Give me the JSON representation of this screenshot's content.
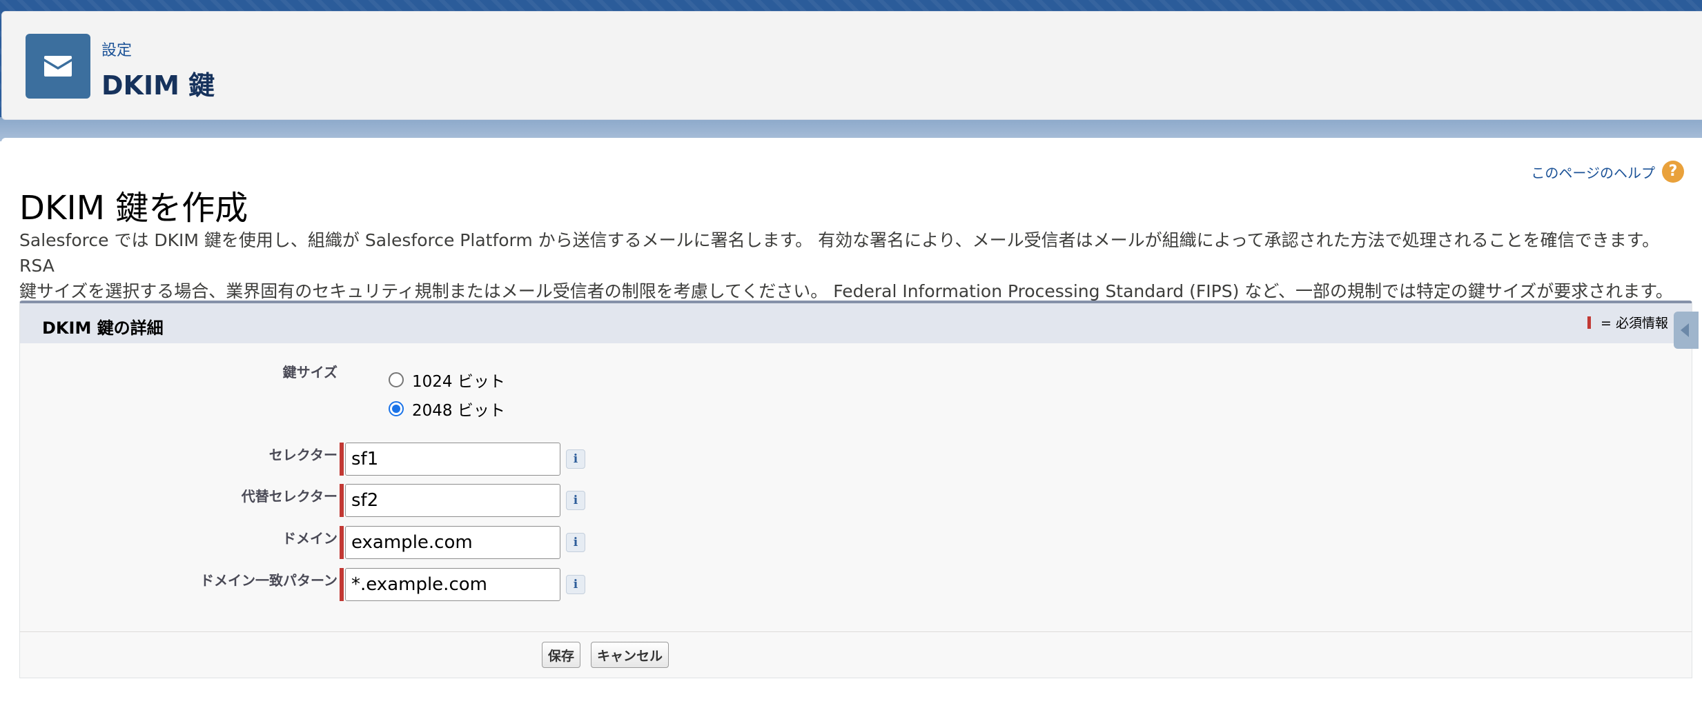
{
  "header": {
    "breadcrumb": "設定",
    "title": "DKIM 鍵",
    "icon": "envelope-icon"
  },
  "page": {
    "heading": "DKIM 鍵を作成",
    "help_link": "このページのヘルプ",
    "help_icon": "help-icon",
    "intro_line1": "Salesforce では DKIM 鍵を使用し、組織が Salesforce Platform から送信するメールに署名します。 有効な署名により、メール受信者はメールが組織によって承認された方法で処理されることを確信できます。 RSA",
    "intro_line2": "鍵サイズを選択する場合、業界固有のセキュリティ規制またはメール受信者の制限を考慮してください。 Federal Information Processing Standard (FIPS) など、一部の規制では特定の鍵サイズが要求されます。"
  },
  "section": {
    "title": "DKIM 鍵の詳細",
    "required_legend": "= 必須情報"
  },
  "form": {
    "key_size_label": "鍵サイズ",
    "key_size_options": [
      {
        "label": "1024 ビット",
        "checked": false
      },
      {
        "label": "2048 ビット",
        "checked": true
      }
    ],
    "selector_label": "セレクター",
    "selector_value": "sf1",
    "alt_selector_label": "代替セレクター",
    "alt_selector_value": "sf2",
    "domain_label": "ドメイン",
    "domain_value": "example.com",
    "domain_pattern_label": "ドメイン一致パターン",
    "domain_pattern_value": "*.example.com",
    "info_glyph": "i"
  },
  "buttons": {
    "save": "保存",
    "cancel": "キャンセル"
  },
  "colors": {
    "header_icon_bg": "#3c6f9e",
    "link": "#1b5297",
    "required": "#c23934",
    "help_icon": "#e9a13b"
  }
}
